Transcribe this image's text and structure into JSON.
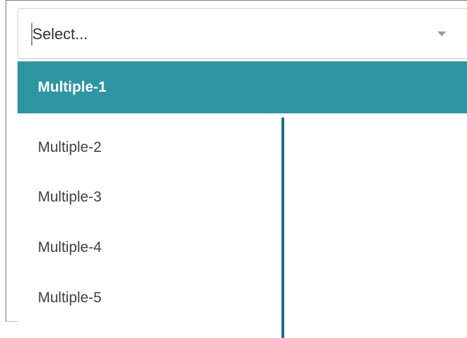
{
  "select": {
    "placeholder": "Select..."
  },
  "menu": {
    "options": [
      {
        "label": "Multiple-1",
        "selected": true
      },
      {
        "label": "Multiple-2",
        "selected": false
      },
      {
        "label": "Multiple-3",
        "selected": false
      },
      {
        "label": "Multiple-4",
        "selected": false
      },
      {
        "label": "Multiple-5",
        "selected": false
      }
    ]
  },
  "colors": {
    "selected_bg": "#2e95a2",
    "selected_text": "#ffffff",
    "option_text": "#3f3f3f",
    "divider": "#1f6f7b"
  },
  "icons": {
    "dropdown_arrow": "chevron-down-icon"
  }
}
